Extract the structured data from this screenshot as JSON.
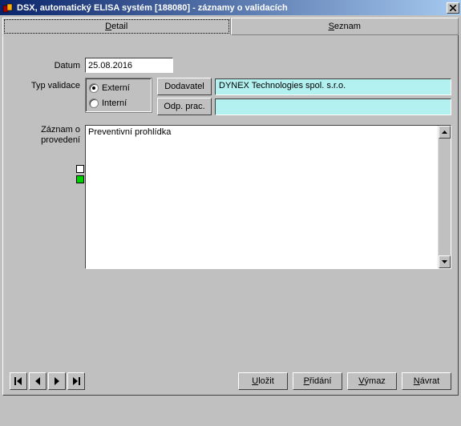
{
  "window": {
    "title": "DSX, automatický ELISA systém  [188080] - záznamy o validacích"
  },
  "tabs": {
    "detail": "Detail",
    "seznam": "Seznam"
  },
  "form": {
    "date_label": "Datum",
    "date_value": "25.08.2016",
    "type_label": "Typ validace",
    "radio_external": "Externí",
    "radio_internal": "Interní",
    "supplier_btn": "Dodavatel",
    "supplier_value": "DYNEX Technologies spol. s.r.o.",
    "responsible_btn": "Odp. prac.",
    "responsible_value": "",
    "record_label_line1": "Záznam o",
    "record_label_line2": "provedení",
    "record_text": "Preventivní prohlídka"
  },
  "actions": {
    "save": "Uložit",
    "add": "Přidání",
    "delete": "Výmaz",
    "back": "Návrat"
  },
  "icons": {
    "first": "first",
    "prev": "prev",
    "next": "next",
    "last": "last"
  }
}
